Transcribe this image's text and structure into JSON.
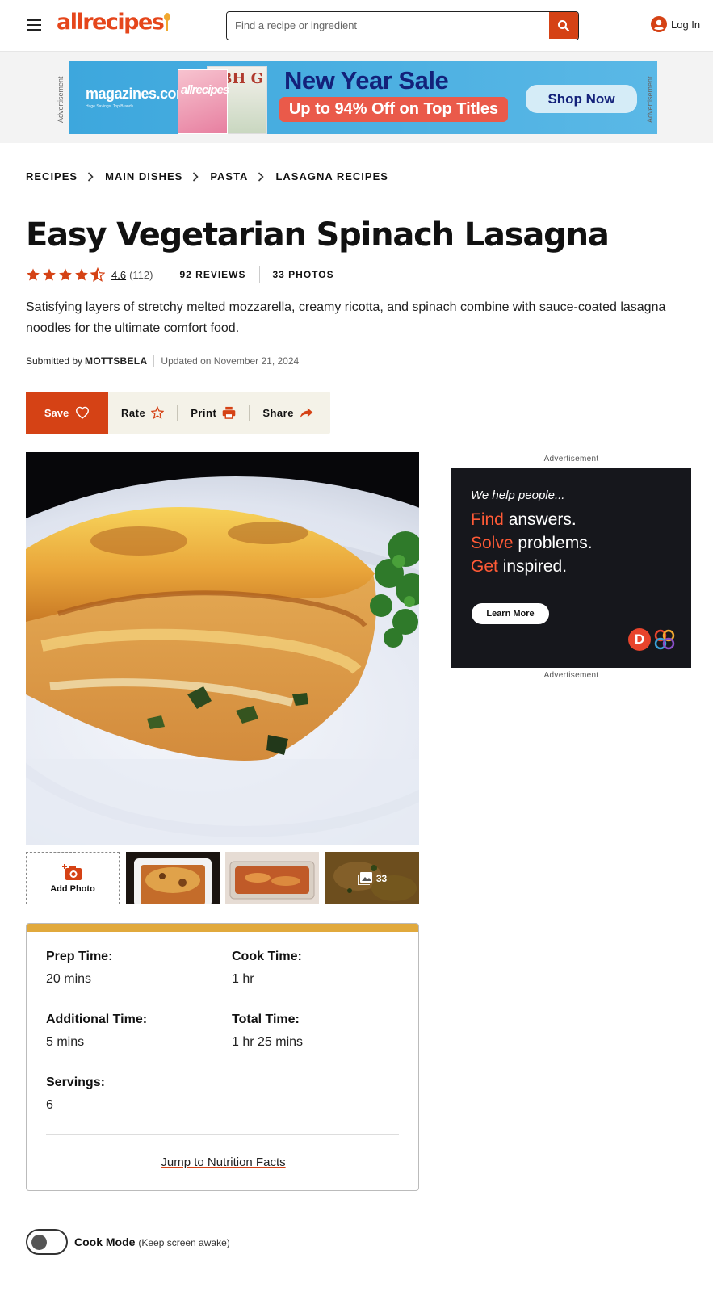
{
  "header": {
    "logo_text": "allrecipes",
    "search_placeholder": "Find a recipe or ingredient",
    "login_label": "Log In"
  },
  "top_ad": {
    "side_label": "Advertisement",
    "brand": "magazines.com",
    "brand_tagline": "Huge Savings. Top Brands.",
    "cover1_text": "allrecipes",
    "cover2_text": "BH G",
    "headline": "New Year Sale",
    "subline": "Up to 94% Off on Top Titles",
    "cta": "Shop Now"
  },
  "breadcrumb": [
    "RECIPES",
    "MAIN DISHES",
    "PASTA",
    "LASAGNA RECIPES"
  ],
  "recipe": {
    "title": "Easy Vegetarian Spinach Lasagna",
    "rating": "4.6",
    "rating_stars": 4.5,
    "rating_count": "(112)",
    "reviews_link": "92 REVIEWS",
    "photos_link": "33 PHOTOS",
    "description": "Satisfying layers of stretchy melted mozzarella, creamy ricotta, and spinach combine with sauce-coated lasagna noodles for the ultimate comfort food.",
    "submitted_prefix": "Submitted by",
    "author": "MOTTSBELA",
    "updated": "Updated on November 21, 2024"
  },
  "actions": {
    "save": "Save",
    "rate": "Rate",
    "print": "Print",
    "share": "Share"
  },
  "gallery": {
    "add_photo": "Add Photo",
    "more_count": "33"
  },
  "times": {
    "prep_label": "Prep Time:",
    "prep_value": "20 mins",
    "cook_label": "Cook Time:",
    "cook_value": "1 hr",
    "additional_label": "Additional Time:",
    "additional_value": "5 mins",
    "total_label": "Total Time:",
    "total_value": "1 hr 25 mins",
    "servings_label": "Servings:",
    "servings_value": "6",
    "jump_link": "Jump to Nutrition Facts"
  },
  "cook_mode": {
    "label": "Cook Mode",
    "note": "(Keep screen awake)"
  },
  "side_ad": {
    "label_top": "Advertisement",
    "label_bottom": "Advertisement",
    "intro": "We help people...",
    "line1_hl": "Find",
    "line1_rest": " answers.",
    "line2_hl": "Solve",
    "line2_rest": " problems.",
    "line3_hl": "Get",
    "line3_rest": " inspired.",
    "cta": "Learn More",
    "logo_letter": "D"
  },
  "colors": {
    "brand_orange": "#d54215",
    "card_accent": "#e1a93c",
    "action_bg": "#f4f2e8",
    "ad_highlight": "#ff5a36"
  }
}
